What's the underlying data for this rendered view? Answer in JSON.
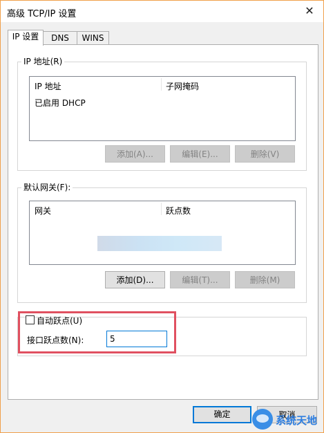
{
  "window": {
    "title": "高级 TCP/IP 设置",
    "close_glyph": "✕"
  },
  "tabs": [
    {
      "label": "IP 设置"
    },
    {
      "label": "DNS"
    },
    {
      "label": "WINS"
    }
  ],
  "ip_address_group": {
    "legend": "IP 地址(R)",
    "columns": [
      "IP 地址",
      "子网掩码"
    ],
    "rows": [
      "已启用 DHCP"
    ],
    "buttons": {
      "add": "添加(A)...",
      "edit": "编辑(E)...",
      "delete": "删除(V)"
    }
  },
  "gateway_group": {
    "legend": "默认网关(F):",
    "columns": [
      "网关",
      "跃点数"
    ],
    "buttons": {
      "add": "添加(D)...",
      "edit": "编辑(T)...",
      "delete": "删除(M)"
    }
  },
  "metric": {
    "auto_label": "自动跃点(U)",
    "auto_checked": false,
    "interface_label": "接口跃点数(N):",
    "interface_value": "5"
  },
  "footer": {
    "ok": "确定",
    "cancel": "取消"
  },
  "watermark": {
    "text": "系统天地"
  }
}
